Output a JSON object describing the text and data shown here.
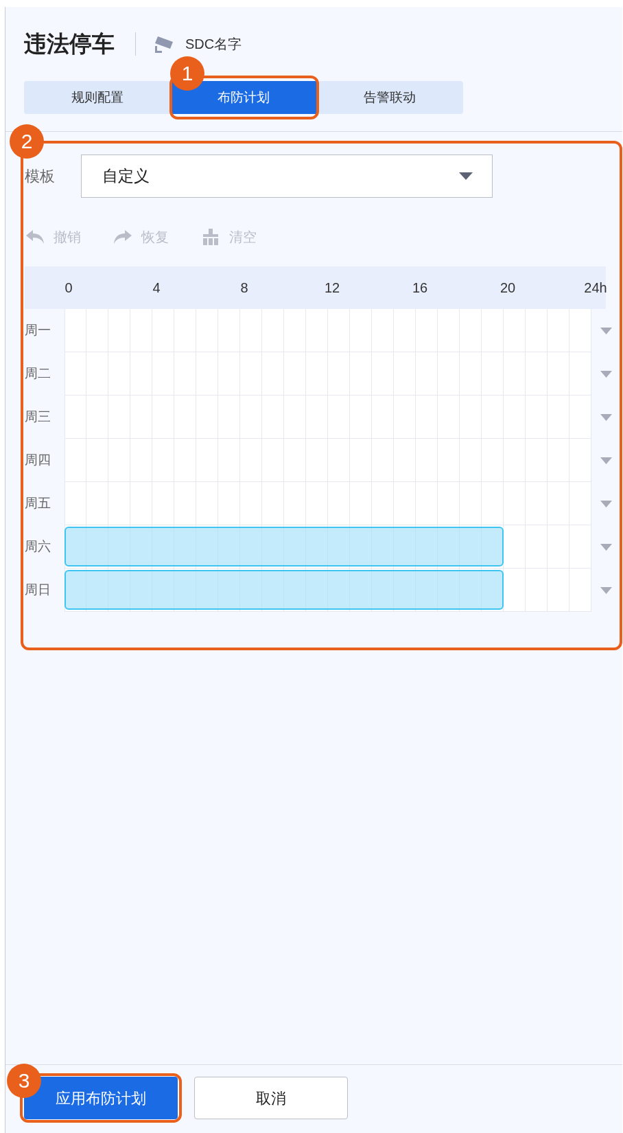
{
  "header": {
    "title": "违法停车",
    "device": "SDC名字"
  },
  "tabs": [
    {
      "label": "规则配置",
      "selected": false
    },
    {
      "label": "布防计划",
      "selected": true
    },
    {
      "label": "告警联动",
      "selected": false
    }
  ],
  "template": {
    "label": "模板",
    "value": "自定义"
  },
  "toolbar": [
    {
      "kind": "undo",
      "label": "撤销",
      "disabled": true
    },
    {
      "kind": "redo",
      "label": "恢复",
      "disabled": true
    },
    {
      "kind": "clear",
      "label": "清空",
      "disabled": true
    }
  ],
  "schedule": {
    "hour_labels": [
      "0",
      "4",
      "8",
      "12",
      "16",
      "20",
      "24h"
    ],
    "days": [
      {
        "label": "周一",
        "level": 0
      },
      {
        "label": "周二",
        "level": 0
      },
      {
        "label": "周三",
        "level": 0
      },
      {
        "label": "周四",
        "level": 0
      },
      {
        "label": "周五",
        "level": 0
      },
      {
        "label": "周六",
        "level": 0.8333
      },
      {
        "label": "周日",
        "level": 0.8333
      }
    ]
  },
  "buttons": [
    {
      "label": "应用布防计划",
      "kind": "primary"
    },
    {
      "label": "取消",
      "kind": "secondary"
    }
  ],
  "callouts": [
    "1",
    "2",
    "3"
  ]
}
